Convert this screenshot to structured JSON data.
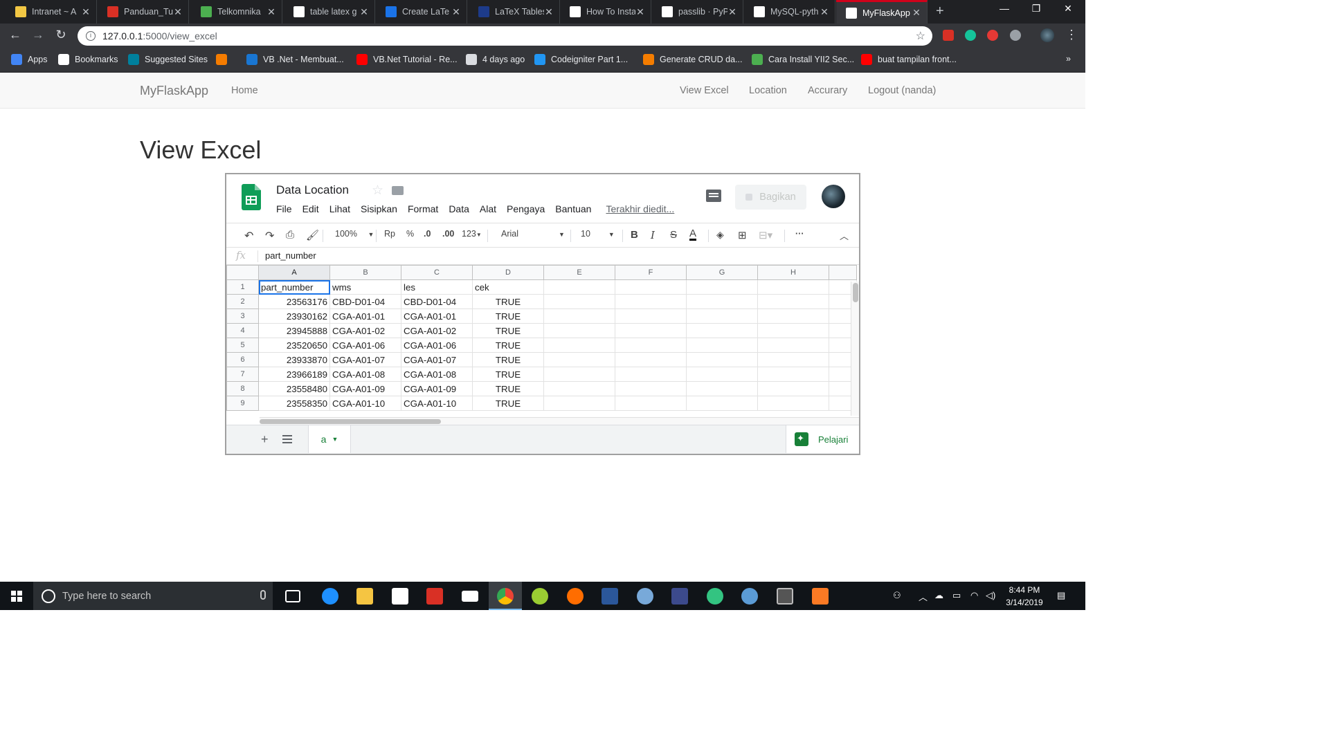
{
  "browser": {
    "tabs": [
      {
        "label": "Intranet ~ A",
        "icon": "intranet-icon",
        "color": "#f2c744"
      },
      {
        "label": "Panduan_Tu",
        "icon": "pdf-icon",
        "color": "#d93025"
      },
      {
        "label": "Telkomnika",
        "icon": "telkomnika-icon",
        "color": "#4caf50"
      },
      {
        "label": "table latex g",
        "icon": "google-icon",
        "color": "#ffffff"
      },
      {
        "label": "Create LaTe",
        "icon": "table-icon",
        "color": "#1a73e8"
      },
      {
        "label": "LaTeX Tables",
        "icon": "latex-icon",
        "color": "#1d3b8a"
      },
      {
        "label": "How To Insta",
        "icon": "page-icon",
        "color": "#ffffff"
      },
      {
        "label": "passlib · PyP",
        "icon": "pypi-icon",
        "color": "#ffffff"
      },
      {
        "label": "MySQL-pyth",
        "icon": "pypi-icon",
        "color": "#ffffff"
      },
      {
        "label": "MyFlaskApp",
        "icon": "document-icon",
        "color": "#ffffff",
        "active": true
      }
    ],
    "new_tab_symbol": "+",
    "window_controls": {
      "minimize": "—",
      "restore": "❐",
      "close": "✕"
    },
    "url_host": "127.0.0.1",
    "url_path": ":5000/view_excel",
    "bookmarks": [
      {
        "label": "Apps",
        "icon": "apps-grid-icon",
        "color": "#4285f4"
      },
      {
        "label": "Bookmarks",
        "icon": "star-icon",
        "color": "#ffffff"
      },
      {
        "label": "Suggested Sites",
        "icon": "bing-icon",
        "color": "#00809d"
      },
      {
        "label": "",
        "icon": "rss-icon",
        "color": "#f57c00"
      },
      {
        "label": "VB .Net - Membuat...",
        "icon": "vb-icon",
        "color": "#1976d2"
      },
      {
        "label": "VB.Net Tutorial - Re...",
        "icon": "youtube-icon",
        "color": "#ff0000"
      },
      {
        "label": "4 days ago",
        "icon": "page-icon",
        "color": "#dadce0"
      },
      {
        "label": "Codeigniter Part 1...",
        "icon": "codeigniter-icon",
        "color": "#2196f3"
      },
      {
        "label": "Generate CRUD da...",
        "icon": "blogger-icon",
        "color": "#f57d00"
      },
      {
        "label": "Cara Install YII2 Sec...",
        "icon": "yii-icon",
        "color": "#4caf50"
      },
      {
        "label": "buat tampilan front...",
        "icon": "youtube-icon",
        "color": "#ff0000"
      }
    ],
    "bookmarks_more": "»"
  },
  "app": {
    "brand": "MyFlaskApp",
    "home": "Home",
    "nav_right": [
      "View Excel",
      "Location",
      "Accurary",
      "Logout (nanda)"
    ],
    "page_title": "View Excel"
  },
  "sheet": {
    "title": "Data Location",
    "menu": [
      "File",
      "Edit",
      "Lihat",
      "Sisipkan",
      "Format",
      "Data",
      "Alat",
      "Pengaya",
      "Bantuan"
    ],
    "last_edit": "Terakhir diedit...",
    "share_label": "Bagikan",
    "toolbar": {
      "zoom": "100%",
      "currency": "Rp",
      "percent": "%",
      "dec_less": ".0",
      "dec_more": ".00",
      "more_formats": "123",
      "font": "Arial",
      "font_size": "10",
      "bold": "B",
      "italic": "I",
      "strike": "S",
      "text_color": "A",
      "more": "···"
    },
    "formula_label": "fx",
    "formula_value": "part_number",
    "columns": [
      "A",
      "B",
      "C",
      "D",
      "E",
      "F",
      "G",
      "H"
    ],
    "header_row": [
      "part_number",
      "wms",
      "les",
      "cek"
    ],
    "rows": [
      [
        "23563176",
        "CBD-D01-04",
        "CBD-D01-04",
        "TRUE"
      ],
      [
        "23930162",
        "CGA-A01-01",
        "CGA-A01-01",
        "TRUE"
      ],
      [
        "23945888",
        "CGA-A01-02",
        "CGA-A01-02",
        "TRUE"
      ],
      [
        "23520650",
        "CGA-A01-06",
        "CGA-A01-06",
        "TRUE"
      ],
      [
        "23933870",
        "CGA-A01-07",
        "CGA-A01-07",
        "TRUE"
      ],
      [
        "23966189",
        "CGA-A01-08",
        "CGA-A01-08",
        "TRUE"
      ],
      [
        "23558480",
        "CGA-A01-09",
        "CGA-A01-09",
        "TRUE"
      ],
      [
        "23558350",
        "CGA-A01-10",
        "CGA-A01-10",
        "TRUE"
      ]
    ],
    "sheet_tab": "a",
    "add_sheet": "+",
    "explore_label": "Pelajari"
  },
  "taskbar": {
    "search_placeholder": "Type here to search",
    "time": "8:44 PM",
    "date": "3/14/2019"
  }
}
